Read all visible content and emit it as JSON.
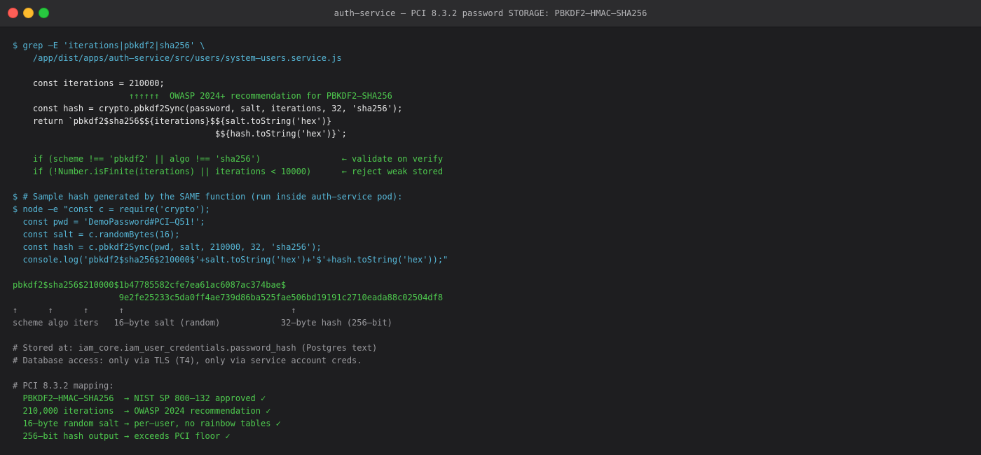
{
  "window": {
    "title": "auth–service — PCI 8.3.2 password STORAGE: PBKDF2–HMAC–SHA256"
  },
  "terminal": {
    "lines": [
      {
        "text": "$ grep –E 'iterations|pbkdf2|sha256' \\",
        "color": "cyan"
      },
      {
        "text": "    /app/dist/apps/auth–service/src/users/system–users.service.js",
        "color": "cyan"
      },
      {
        "text": "",
        "color": "white"
      },
      {
        "text": "    const iterations = 210000;",
        "color": "white"
      },
      {
        "text": "                       ↑↑↑↑↑↑  OWASP 2024+ recommendation for PBKDF2–SHA256",
        "color": "green"
      },
      {
        "text": "    const hash = crypto.pbkdf2Sync(password, salt, iterations, 32, 'sha256');",
        "color": "white"
      },
      {
        "text": "    return `pbkdf2$sha256$${iterations}$${salt.toString('hex')}",
        "color": "white"
      },
      {
        "text": "                                        $${hash.toString('hex')}`;",
        "color": "white"
      },
      {
        "text": "",
        "color": "white"
      },
      {
        "text": "    if (scheme !== 'pbkdf2' || algo !== 'sha256')                ← validate on verify",
        "color": "green"
      },
      {
        "text": "    if (!Number.isFinite(iterations) || iterations < 10000)      ← reject weak stored",
        "color": "green"
      },
      {
        "text": "",
        "color": "white"
      },
      {
        "text": "$ # Sample hash generated by the SAME function (run inside auth–service pod):",
        "color": "cyan"
      },
      {
        "text": "$ node –e \"const c = require('crypto');",
        "color": "cyan"
      },
      {
        "text": "  const pwd = 'DemoPassword#PCI–Q51!';",
        "color": "cyan"
      },
      {
        "text": "  const salt = c.randomBytes(16);",
        "color": "cyan"
      },
      {
        "text": "  const hash = c.pbkdf2Sync(pwd, salt, 210000, 32, 'sha256');",
        "color": "cyan"
      },
      {
        "text": "  console.log('pbkdf2$sha256$210000$'+salt.toString('hex')+'$'+hash.toString('hex'));\"",
        "color": "cyan"
      },
      {
        "text": "",
        "color": "white"
      },
      {
        "text": "pbkdf2$sha256$210000$1b47785582cfe7ea61ac6087ac374bae$",
        "color": "green"
      },
      {
        "text": "                     9e2fe25233c5da0ff4ae739d86ba525fae506bd19191c2710eada88c02504df8",
        "color": "green"
      },
      {
        "text": "↑      ↑      ↑      ↑                                 ↑",
        "color": "gray"
      },
      {
        "text": "scheme algo iters   16–byte salt (random)            32–byte hash (256–bit)",
        "color": "gray"
      },
      {
        "text": "",
        "color": "white"
      },
      {
        "text": "# Stored at: iam_core.iam_user_credentials.password_hash (Postgres text)",
        "color": "gray"
      },
      {
        "text": "# Database access: only via TLS (T4), only via service account creds.",
        "color": "gray"
      },
      {
        "text": "",
        "color": "white"
      },
      {
        "text": "# PCI 8.3.2 mapping:",
        "color": "gray"
      },
      {
        "text": "  PBKDF2–HMAC–SHA256  → NIST SP 800–132 approved ✓",
        "color": "green"
      },
      {
        "text": "  210,000 iterations  → OWASP 2024 recommendation ✓",
        "color": "green"
      },
      {
        "text": "  16–byte random salt → per–user, no rainbow tables ✓",
        "color": "green"
      },
      {
        "text": "  256–bit hash output → exceeds PCI floor ✓",
        "color": "green"
      }
    ]
  },
  "colors": {
    "cyan": "#56b6d6",
    "white": "#e8e8e8",
    "green": "#4ec94e",
    "gray": "#9a9a9e"
  }
}
